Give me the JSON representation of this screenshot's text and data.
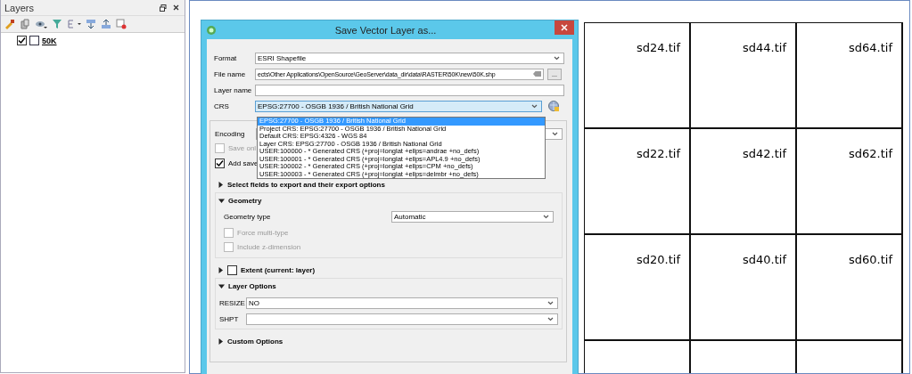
{
  "layers_panel": {
    "title": "Layers",
    "layers": [
      {
        "name": "50K",
        "visible": true,
        "selected": false
      }
    ]
  },
  "map_tiles": [
    "sd24.tif",
    "sd44.tif",
    "sd64.tif",
    "sd22.tif",
    "sd42.tif",
    "sd62.tif",
    "sd20.tif",
    "sd40.tif",
    "sd60.tif"
  ],
  "dialog": {
    "title": "Save Vector Layer as...",
    "fields": [
      {
        "label": "Format",
        "kind": "combo",
        "value": "ESRI Shapefile"
      },
      {
        "label": "File name",
        "kind": "file",
        "value": "ects\\Other Applications\\OpenSource\\GeoServer\\data_dir\\data\\RASTER\\50K\\new\\50K.shp",
        "button": "..."
      },
      {
        "label": "Layer name",
        "kind": "text"
      },
      {
        "label": "CRS",
        "kind": "crs",
        "value": "EPSG:27700 - OSGB 1936 / British National Grid"
      }
    ],
    "crs_options": [
      {
        "label": "EPSG:27700 - OSGB 1936 / British National Grid",
        "selected": true
      },
      {
        "label": "Project CRS: EPSG:27700 - OSGB 1936 / British National Grid",
        "selected": false
      },
      {
        "label": "Default CRS: EPSG:4326 - WGS 84",
        "selected": false
      },
      {
        "label": "Layer CRS: EPSG:27700 - OSGB 1936 / British National Grid",
        "selected": false
      },
      {
        "label": "USER:100000 -  * Generated CRS (+proj=longlat +ellps=andrae +no_defs)",
        "selected": false
      },
      {
        "label": "USER:100001 -  * Generated CRS (+proj=longlat +ellps=APL4.9 +no_defs)",
        "selected": false
      },
      {
        "label": "USER:100002 -  * Generated CRS (+proj=longlat +ellps=CPM +no_defs)",
        "selected": false
      },
      {
        "label": "USER:100003 -  * Generated CRS (+proj=longlat +ellps=delmbr +no_defs)",
        "selected": false
      }
    ],
    "encoding_label": "Encoding",
    "checkboxes": [
      {
        "label": "Save onl",
        "checked": false,
        "disabled": true
      },
      {
        "label": "Add save",
        "checked": true,
        "disabled": false
      }
    ],
    "select_fields": {
      "title": "Select fields to export and their export options",
      "expanded": false
    },
    "geometry": {
      "title": "Geometry",
      "expanded": true,
      "type_label": "Geometry type",
      "type_value": "Automatic",
      "options": [
        {
          "label": "Force multi-type",
          "checked": false,
          "disabled": true
        },
        {
          "label": "Include z-dimension",
          "checked": false,
          "disabled": true
        }
      ]
    },
    "extent": {
      "title": "Extent (current: layer)",
      "expanded": false,
      "checked": false
    },
    "layer_options": {
      "title": "Layer Options",
      "expanded": true,
      "options": [
        {
          "label": "RESIZE",
          "value": "NO"
        },
        {
          "label": "SHPT"
        }
      ]
    },
    "custom_options": {
      "title": "Custom Options",
      "expanded": false
    }
  }
}
